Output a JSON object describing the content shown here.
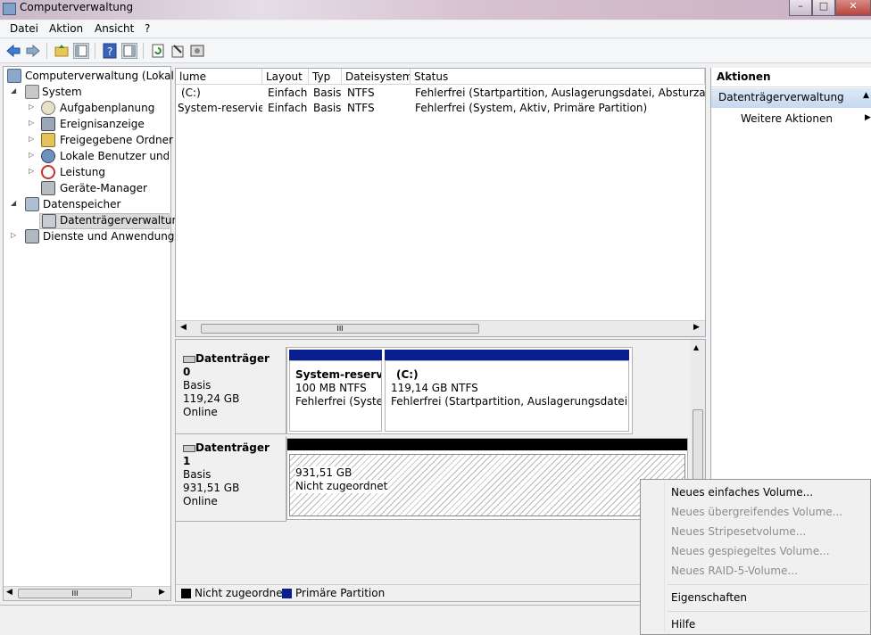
{
  "window": {
    "title": "Computerverwaltung"
  },
  "menubar": {
    "items": [
      "Datei",
      "Aktion",
      "Ansicht",
      "?"
    ]
  },
  "tree": {
    "root": "Computerverwaltung (Lokal)",
    "system": "System",
    "aufgabenplanung": "Aufgabenplanung",
    "ereignisanzeige": "Ereignisanzeige",
    "freigegebene": "Freigegebene Ordner",
    "lokale_benutzer": "Lokale Benutzer und Gr",
    "leistung": "Leistung",
    "geraete_manager": "Geräte-Manager",
    "datenspeicher": "Datenspeicher",
    "datentraegerverwaltung": "Datenträgerverwaltung",
    "dienste": "Dienste und Anwendungen"
  },
  "volume_list": {
    "columns": [
      "lume",
      "Layout",
      "Typ",
      "Dateisystem",
      "Status"
    ],
    "rows": [
      {
        "volume": "(C:)",
        "layout": "Einfach",
        "typ": "Basis",
        "fs": "NTFS",
        "status": "Fehlerfrei (Startpartition, Auslagerungsdatei, Absturzabbild, Pr"
      },
      {
        "volume": "System-reserviert",
        "layout": "Einfach",
        "typ": "Basis",
        "fs": "NTFS",
        "status": "Fehlerfrei (System, Aktiv, Primäre Partition)"
      }
    ],
    "hscroll_glyph": "III"
  },
  "disks": [
    {
      "name": "Datenträger 0",
      "type": "Basis",
      "size": "119,24 GB",
      "state": "Online",
      "partitions": [
        {
          "title": "System-reservie",
          "size": "100 MB NTFS",
          "status": "Fehlerfrei (System"
        },
        {
          "title": "(C:)",
          "size": "119,14 GB NTFS",
          "status": "Fehlerfrei (Startpartition, Auslagerungsdatei, Abst"
        }
      ]
    },
    {
      "name": "Datenträger 1",
      "type": "Basis",
      "size": "931,51 GB",
      "state": "Online",
      "partitions": [
        {
          "size": "931,51 GB",
          "status": "Nicht zugeordnet"
        }
      ]
    }
  ],
  "legend": [
    {
      "label": "Nicht zugeordnet",
      "color": "#000000"
    },
    {
      "label": "Primäre Partition",
      "color": "#0a1f8f"
    }
  ],
  "actions": {
    "header": "Aktionen",
    "section": "Datenträgerverwaltung",
    "more": "Weitere Aktionen"
  },
  "context_menu": {
    "items": [
      {
        "label": "Neues einfaches Volume...",
        "enabled": true
      },
      {
        "label": "Neues übergreifendes Volume...",
        "enabled": false
      },
      {
        "label": "Neues Stripesetvolume...",
        "enabled": false
      },
      {
        "label": "Neues gespiegeltes Volume...",
        "enabled": false
      },
      {
        "label": "Neues RAID-5-Volume...",
        "enabled": false
      },
      {
        "label": "Eigenschaften",
        "enabled": true
      },
      {
        "label": "Hilfe",
        "enabled": true
      }
    ]
  },
  "tree_hscroll_glyph": "III",
  "colors": {
    "partition_header": "#0a1f8f",
    "unallocated_header": "#000000",
    "action_section": "#cfe1f5"
  }
}
